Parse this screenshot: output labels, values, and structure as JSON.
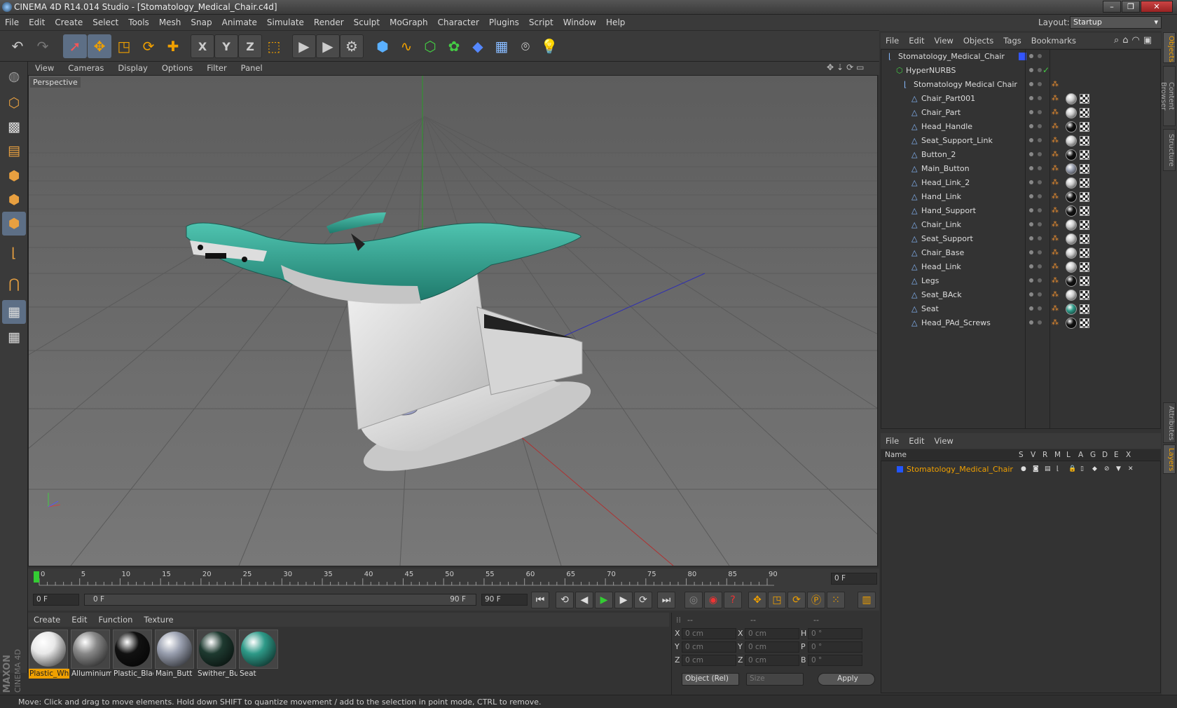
{
  "window": {
    "title": "CINEMA 4D R14.014 Studio - [Stomatology_Medical_Chair.c4d]",
    "min": "–",
    "max": "❐",
    "close": "✕"
  },
  "menu": [
    "File",
    "Edit",
    "Create",
    "Select",
    "Tools",
    "Mesh",
    "Snap",
    "Animate",
    "Simulate",
    "Render",
    "Sculpt",
    "MoGraph",
    "Character",
    "Plugins",
    "Script",
    "Window",
    "Help"
  ],
  "layout": {
    "label": "Layout:",
    "value": "Startup"
  },
  "toolbar_icons": [
    "undo-icon",
    "redo-icon",
    "live-selection-icon",
    "move-icon",
    "scale-icon",
    "rotate-icon",
    "recent-tool-icon",
    "x-axis-icon",
    "y-axis-icon",
    "z-axis-icon",
    "coordinate-system-icon",
    "render-view-icon",
    "render-picture-viewer-icon",
    "render-settings-icon",
    "cube-icon",
    "spline-icon",
    "nurbs-icon",
    "array-icon",
    "deformer-icon",
    "floor-icon",
    "camera-icon",
    "light-icon"
  ],
  "axis": {
    "x": "X",
    "y": "Y",
    "z": "Z"
  },
  "viewport": {
    "menu": [
      "View",
      "Cameras",
      "Display",
      "Options",
      "Filter",
      "Panel"
    ],
    "label": "Perspective"
  },
  "timeline": {
    "ticks": [
      "0",
      "5",
      "10",
      "15",
      "20",
      "25",
      "30",
      "35",
      "40",
      "45",
      "50",
      "55",
      "60",
      "65",
      "70",
      "75",
      "80",
      "85",
      "90"
    ],
    "current_frame": "0 F",
    "start": "0 F",
    "range_start": "0 F",
    "range_end": "90 F",
    "end": "90 F"
  },
  "material_menu": [
    "Create",
    "Edit",
    "Function",
    "Texture"
  ],
  "materials": [
    {
      "name": "Plastic_Wh",
      "color": "#e8e8e8",
      "selected": true
    },
    {
      "name": "Alluminium",
      "color": "#888888",
      "selected": false
    },
    {
      "name": "Plastic_Blac",
      "color": "#111111",
      "selected": false
    },
    {
      "name": "Main_Butt",
      "color": "#9aa0b0",
      "selected": false
    },
    {
      "name": "Swither_Bu",
      "color": "#1e3a30",
      "selected": false
    },
    {
      "name": "Seat",
      "color": "#2e9a88",
      "selected": false
    }
  ],
  "coords": {
    "headers": [
      "--",
      "--",
      "--"
    ],
    "rows": [
      {
        "l1": "X",
        "v1": "0 cm",
        "l2": "X",
        "v2": "0 cm",
        "l3": "H",
        "v3": "0 °"
      },
      {
        "l1": "Y",
        "v1": "0 cm",
        "l2": "Y",
        "v2": "0 cm",
        "l3": "P",
        "v3": "0 °"
      },
      {
        "l1": "Z",
        "v1": "0 cm",
        "l2": "Z",
        "v2": "0 cm",
        "l3": "B",
        "v3": "0 °"
      }
    ],
    "mode": "Object (Rel)",
    "size": "Size",
    "apply": "Apply"
  },
  "object_menu": [
    "File",
    "Edit",
    "View",
    "Objects",
    "Tags",
    "Bookmarks"
  ],
  "objects": [
    {
      "name": "Stomatology_Medical_Chair",
      "depth": 0
    },
    {
      "name": "HyperNURBS",
      "depth": 1
    },
    {
      "name": "Stomatology Medical Chair",
      "depth": 2
    },
    {
      "name": "Chair_Part001",
      "depth": 3,
      "mat": "#cfcfcf"
    },
    {
      "name": "Chair_Part",
      "depth": 3,
      "mat": "#cfcfcf"
    },
    {
      "name": "Head_Handle",
      "depth": 3,
      "mat": "#111111"
    },
    {
      "name": "Seat_Support_Link",
      "depth": 3,
      "mat": "#cfcfcf"
    },
    {
      "name": "Button_2",
      "depth": 3,
      "mat": "#111111"
    },
    {
      "name": "Main_Button",
      "depth": 3,
      "mat": "#9aa0b0"
    },
    {
      "name": "Head_Link_2",
      "depth": 3,
      "mat": "#cfcfcf"
    },
    {
      "name": "Hand_Link",
      "depth": 3,
      "mat": "#111111"
    },
    {
      "name": "Hand_Support",
      "depth": 3,
      "mat": "#111111"
    },
    {
      "name": "Chair_Link",
      "depth": 3,
      "mat": "#cfcfcf"
    },
    {
      "name": "Seat_Support",
      "depth": 3,
      "mat": "#cfcfcf"
    },
    {
      "name": "Chair_Base",
      "depth": 3,
      "mat": "#cfcfcf"
    },
    {
      "name": "Head_Link",
      "depth": 3,
      "mat": "#cfcfcf"
    },
    {
      "name": "Legs",
      "depth": 3,
      "mat": "#111111"
    },
    {
      "name": "Seat_BAck",
      "depth": 3,
      "mat": "#cfcfcf"
    },
    {
      "name": "Seat",
      "depth": 3,
      "mat": "#2e9a88"
    },
    {
      "name": "Head_PAd_Screws",
      "depth": 3,
      "mat": "#111111"
    }
  ],
  "layer_menu": [
    "File",
    "Edit",
    "View"
  ],
  "layer_columns": {
    "name": "Name",
    "flags": [
      "S",
      "V",
      "R",
      "M",
      "L",
      "A",
      "G",
      "D",
      "E",
      "X"
    ]
  },
  "layers": [
    {
      "name": "Stomatology_Medical_Chair",
      "color": "#2255ff"
    }
  ],
  "right_tabs": [
    "Objects",
    "Content Browser",
    "Structure",
    "Attributes",
    "Layers"
  ],
  "status": "Move: Click and drag to move elements. Hold down SHIFT to quantize movement / add to the selection in point mode, CTRL to remove.",
  "brand": {
    "line1": "MAXON",
    "line2": "CINEMA 4D"
  },
  "colors": {
    "accent": "#f0a000",
    "active": "#5d6f86",
    "seat": "#2e9a88"
  }
}
